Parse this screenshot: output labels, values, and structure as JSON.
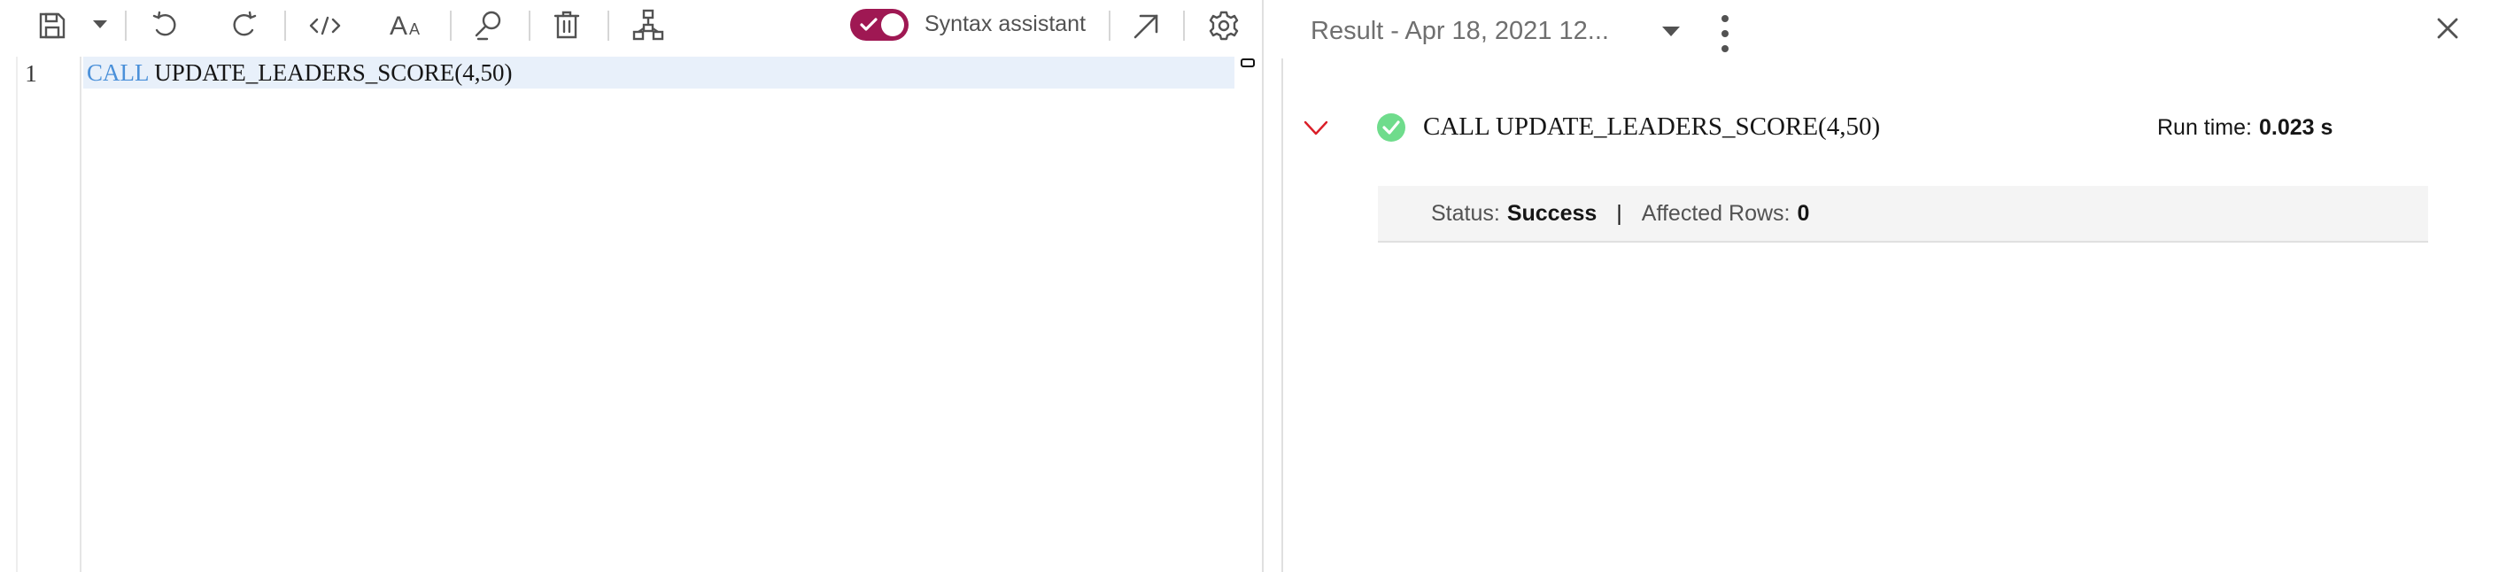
{
  "toolbar": {
    "icons": [
      "save-icon",
      "caret-down-icon",
      "undo-icon",
      "redo-icon",
      "code-icon",
      "font-size-icon",
      "search-icon",
      "trash-icon",
      "flow-icon",
      "launch-icon",
      "gear-icon"
    ],
    "syntax_assistant_label": "Syntax assistant",
    "syntax_assistant_enabled": true,
    "toggle_color": "#9f1853"
  },
  "editor": {
    "line_number": "1",
    "code_keyword": "CALL",
    "code_rest": "UPDATE_LEADERS_SCORE(4,50)",
    "keyword_color": "#4a90d9"
  },
  "result": {
    "title": "Result - Apr 18, 2021 12...",
    "statement": "CALL UPDATE_LEADERS_SCORE(4,50)",
    "run_time_label": "Run time:",
    "run_time_value": "0.023 s",
    "status_label": "Status:",
    "status_value": "Success",
    "separator": "|",
    "affected_rows_label": "Affected Rows:",
    "affected_rows_value": "0",
    "success_color": "#6fdc8c",
    "collapse_color": "#da1e28"
  }
}
